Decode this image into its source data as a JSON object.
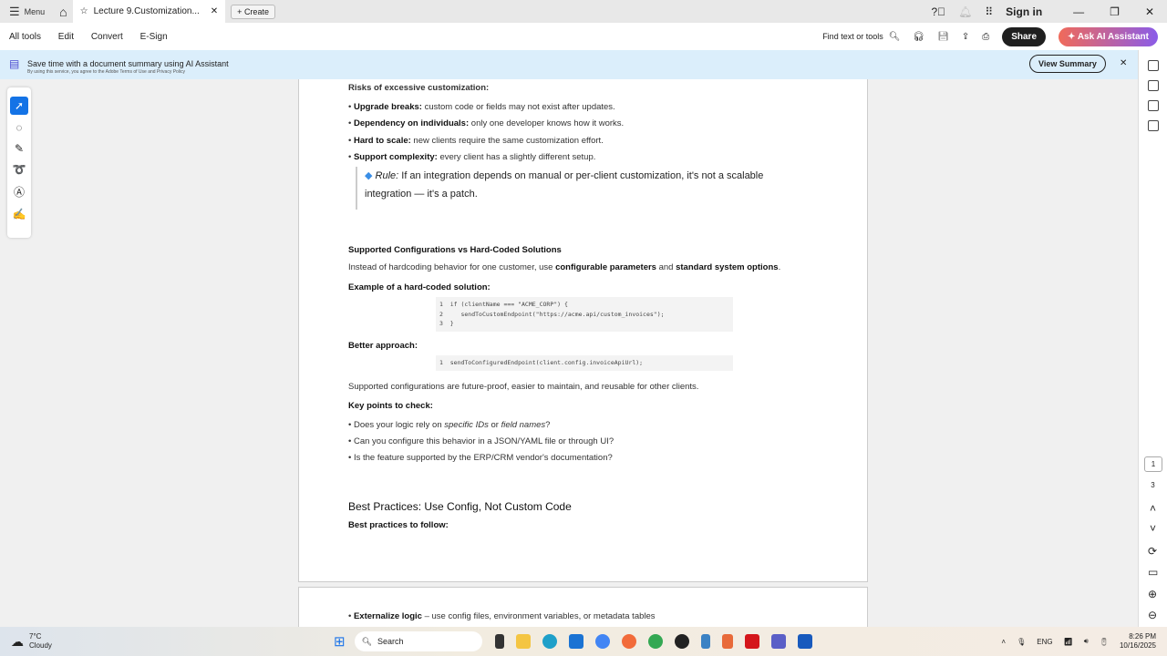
{
  "titlebar": {
    "menu": "Menu",
    "tab_title": "Lecture 9.Customization...",
    "create": "Create",
    "sign_in": "Sign in"
  },
  "toolbar": {
    "items": [
      "All tools",
      "Edit",
      "Convert",
      "E-Sign"
    ],
    "find": "Find text or tools",
    "share": "Share",
    "ask_ai": "Ask AI Assistant"
  },
  "banner": {
    "title": "Save time with a document summary using AI Assistant",
    "subtitle": "By using this service, you agree to the Adobe Terms of Use and Privacy Policy",
    "button": "View Summary"
  },
  "doc": {
    "risks_heading": "Risks of excessive customization:",
    "risks": [
      {
        "b": "Upgrade breaks:",
        "t": " custom code or fields may not exist after updates."
      },
      {
        "b": "Dependency on individuals:",
        "t": " only one developer knows how it works."
      },
      {
        "b": "Hard to scale:",
        "t": " new clients require the same customization effort."
      },
      {
        "b": "Support complexity:",
        "t": " every client has a slightly different setup."
      }
    ],
    "rule_label": "Rule:",
    "rule_line1": " If an integration depends on manual or per-client customization, it's not a scalable",
    "rule_line2": "integration — it's a patch.",
    "supported_heading": "Supported Configurations vs Hard-Coded Solutions",
    "intro_a": "Instead of hardcoding behavior for one customer, use ",
    "intro_b": "configurable parameters",
    "intro_c": " and ",
    "intro_d": "standard system options",
    "intro_e": ".",
    "example_heading": "Example of a hard-coded solution:",
    "code1": "1  if (clientName === \"ACME_CORP\") {\n2     sendToCustomEndpoint(\"https://acme.api/custom_invoices\");\n3  }",
    "better_heading": "Better approach:",
    "code2": "1  sendToConfiguredEndpoint(client.config.invoiceApiUrl);",
    "supported_text": "Supported configurations are future-proof, easier to maintain, and reusable for other clients.",
    "key_heading": "Key points to check:",
    "key1_a": "Does your logic rely on ",
    "key1_b": "specific IDs",
    "key1_c": " or ",
    "key1_d": "field names",
    "key1_e": "?",
    "key2": "Can you configure this behavior in a JSON/YAML file or through UI?",
    "key3": "Is the feature supported by the ERP/CRM vendor's documentation?",
    "best_heading": "Best Practices: Use Config, Not Custom Code",
    "best_sub": "Best practices to follow:",
    "next_b": "Externalize logic",
    "next_t": " – use config files, environment variables, or metadata tables"
  },
  "page_nav": {
    "current": "1",
    "total": "3"
  },
  "taskbar": {
    "temp": "7°C",
    "weather": "Cloudy",
    "search": "Search",
    "lang": "ENG",
    "time": "8:26 PM",
    "date": "10/16/2025"
  }
}
